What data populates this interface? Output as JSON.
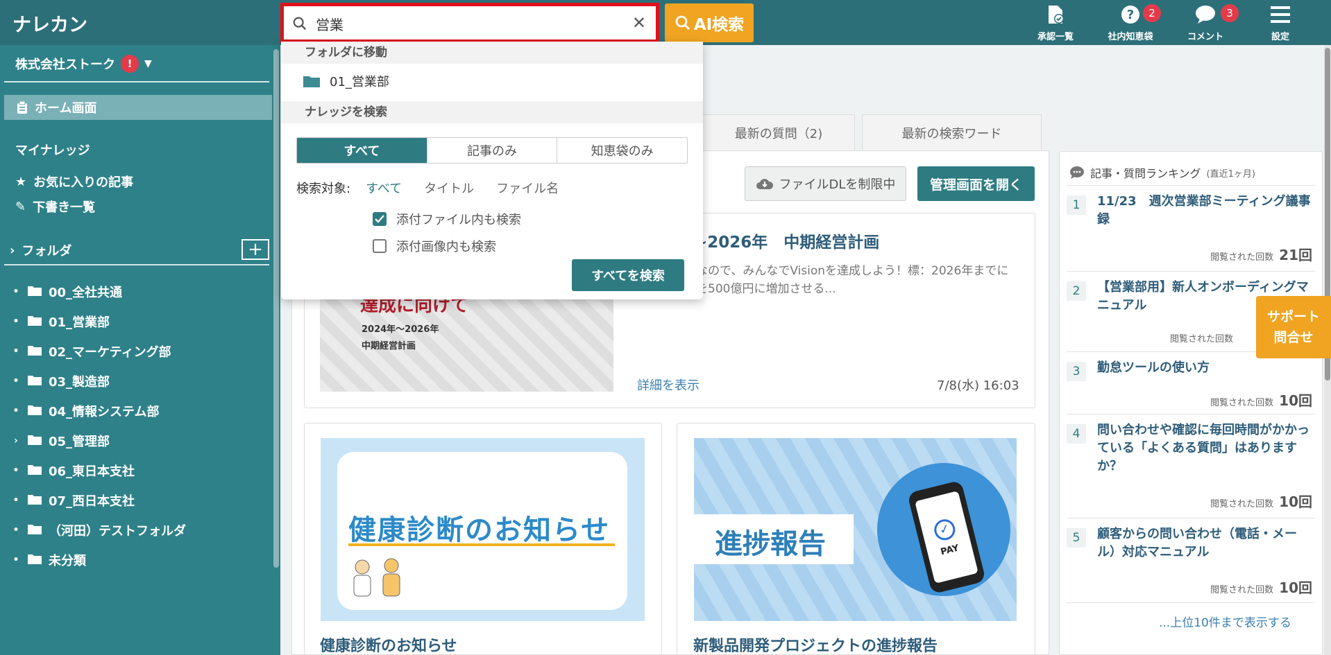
{
  "app": {
    "logo": "ナレカン"
  },
  "search": {
    "value": "営業",
    "ai_button": "AI検索"
  },
  "header_icons": [
    {
      "label": "承認一覧",
      "badge": ""
    },
    {
      "label": "社内知恵袋",
      "badge": "2"
    },
    {
      "label": "コメント",
      "badge": "3"
    },
    {
      "label": "設定",
      "badge": ""
    }
  ],
  "sidebar": {
    "company": "株式会社ストーク",
    "company_alert": "!",
    "home": "ホーム画面",
    "my_knowledge": "マイナレッジ",
    "favorites": "お気に入りの記事",
    "drafts": "下書き一覧",
    "folder_header": "フォルダ",
    "add_folder": "+",
    "folders": [
      "00_全社共通",
      "01_営業部",
      "02_マーケティング部",
      "03_製造部",
      "04_情報システム部",
      "05_管理部",
      "06_東日本支社",
      "07_西日本支社",
      "（河田）テストフォルダ",
      "未分類"
    ]
  },
  "dropdown": {
    "move_folder_header": "フォルダに移動",
    "folder_result": "01_営業部",
    "search_header": "ナレッジを検索",
    "tabs": [
      "すべて",
      "記事のみ",
      "知恵袋のみ"
    ],
    "target_label": "検索対象:",
    "target_options": [
      "すべて",
      "タイトル",
      "ファイル名"
    ],
    "check_attach_file": "添付ファイル内も検索",
    "check_attach_image": "添付画像内も検索",
    "search_all_button": "すべてを検索"
  },
  "main": {
    "tabs": [
      "最新の質問（2)",
      "最新の検索ワード"
    ],
    "file_dl_button": "ファイルDLを制限中",
    "admin_button": "管理画面を開く",
    "featured": {
      "title": "~2026年　中期経営計画",
      "body": "期経営計画なので、みんなでVisionを達成しよう！標：2026年までに年間売上高を500億円に増加させる...",
      "detail_link": "詳細を表示",
      "datetime": "7/8(水) 16:03",
      "thumb_big": "達成に向けて",
      "thumb_sub1": "2024年〜2026年",
      "thumb_sub2": "中期経営計画"
    },
    "cards": [
      {
        "title": "健康診断のお知らせ",
        "image_text": "健康診断のお知らせ"
      },
      {
        "title": "新製品開発プロジェクトの進捗報告",
        "image_text": "進捗報告",
        "phone_text": "PAY"
      }
    ]
  },
  "ranking": {
    "header": "記事・質問ランキング",
    "period": "(直近1ヶ月)",
    "views_label": "閲覧された回数",
    "items": [
      {
        "rank": "1",
        "title": "11/23　週次営業部ミーティング議事録",
        "views": "21回"
      },
      {
        "rank": "2",
        "title": "【営業部用】新人オンボーディングマニュアル",
        "views": ""
      },
      {
        "rank": "3",
        "title": "勤怠ツールの使い方",
        "views": "10回"
      },
      {
        "rank": "4",
        "title": "問い合わせや確認に毎回時間がかかっている「よくある質問」はありますか？",
        "views": "10回"
      },
      {
        "rank": "5",
        "title": "顧客からの問い合わせ（電話・メール）対応マニュアル",
        "views": "10回"
      }
    ],
    "more_link": "...上位10件まで表示する"
  },
  "support": {
    "line1": "サポート",
    "line2": "問合せ"
  }
}
